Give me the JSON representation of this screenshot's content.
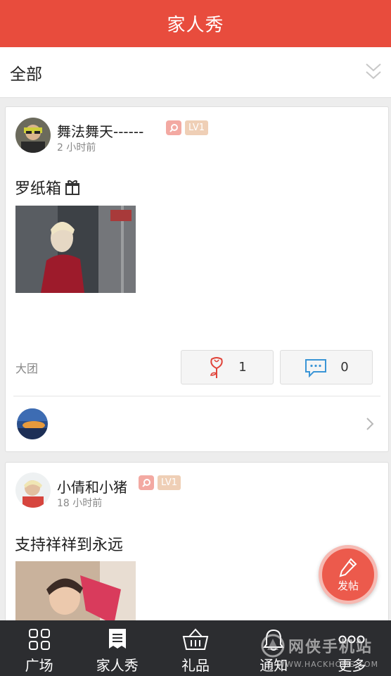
{
  "header": {
    "title": "家人秀"
  },
  "filter": {
    "label": "全部",
    "icon": "double-chevron-down-icon"
  },
  "posts": [
    {
      "username": "舞法舞天------",
      "level": "LV1",
      "time_ago": "2 小时前",
      "title": "罗纸箱",
      "group": "大团",
      "flower_count": "1",
      "comment_count": "0"
    },
    {
      "username": "小倩和小猪",
      "level": "LV1",
      "time_ago": "18 小时前",
      "title": "支持祥祥到永远"
    }
  ],
  "fab": {
    "label": "发帖",
    "icon": "pen-icon"
  },
  "tabs": [
    {
      "label": "广场",
      "icon": "grid-icon"
    },
    {
      "label": "家人秀",
      "icon": "document-icon"
    },
    {
      "label": "礼品",
      "icon": "basket-icon"
    },
    {
      "label": "通知",
      "icon": "bell-icon"
    },
    {
      "label": "更多",
      "icon": "more-dots-icon"
    }
  ],
  "watermark": {
    "main": "网侠手机站",
    "sub": "WWW.HACKHOME.COM"
  },
  "colors": {
    "brand": "#e84c3d",
    "tabbar": "#2c2d30",
    "badge_search": "#f3a9a2",
    "badge_level": "#efcfb6"
  }
}
